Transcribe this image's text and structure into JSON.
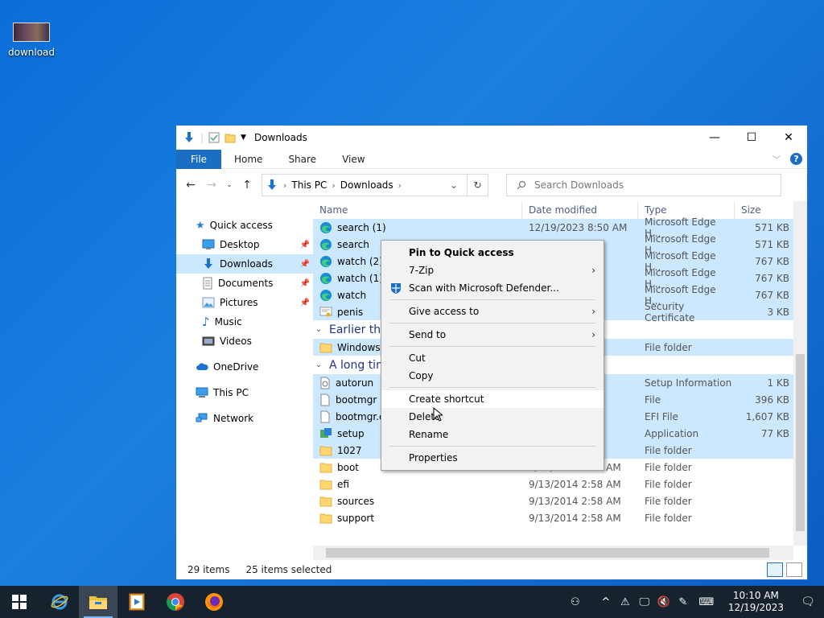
{
  "desktop": {
    "icons": [
      {
        "label": "download"
      }
    ]
  },
  "window": {
    "title": "Downloads",
    "ribbon_tabs": {
      "file": "File",
      "home": "Home",
      "share": "Share",
      "view": "View"
    },
    "address": {
      "root": "This PC",
      "folder": "Downloads"
    },
    "search_placeholder": "Search Downloads"
  },
  "nav_pane": {
    "quick_access": "Quick access",
    "items": [
      {
        "label": "Desktop",
        "icon": "desktop-icon",
        "pinned": true
      },
      {
        "label": "Downloads",
        "icon": "download-icon",
        "pinned": true,
        "selected": true
      },
      {
        "label": "Documents",
        "icon": "documents-icon",
        "pinned": true
      },
      {
        "label": "Pictures",
        "icon": "pictures-icon",
        "pinned": true
      },
      {
        "label": "Music",
        "icon": "music-icon"
      },
      {
        "label": "Videos",
        "icon": "videos-icon"
      }
    ],
    "onedrive": "OneDrive",
    "this_pc": "This PC",
    "network": "Network"
  },
  "columns": {
    "name": "Name",
    "date": "Date modified",
    "type": "Type",
    "size": "Size"
  },
  "files_today": [
    {
      "name": "search (1)",
      "date": "12/19/2023 8:50 AM",
      "type": "Microsoft Edge H...",
      "size": "571 KB",
      "icon": "edge-icon"
    },
    {
      "name": "search",
      "date": "",
      "type": "Microsoft Edge H...",
      "size": "571 KB",
      "icon": "edge-icon"
    },
    {
      "name": "watch (2)",
      "date": "",
      "type": "Microsoft Edge H...",
      "size": "767 KB",
      "icon": "edge-icon"
    },
    {
      "name": "watch (1)",
      "date": "",
      "type": "Microsoft Edge H...",
      "size": "767 KB",
      "icon": "edge-icon"
    },
    {
      "name": "watch",
      "date": "",
      "type": "Microsoft Edge H...",
      "size": "767 KB",
      "icon": "edge-icon"
    },
    {
      "name": "penis",
      "date": "",
      "type": "Security Certificate",
      "size": "3 KB",
      "icon": "certificate-icon"
    }
  ],
  "group_earlier": "Earlier this",
  "files_earlier": [
    {
      "name": "Windows 1",
      "date": "",
      "type": "File folder",
      "size": "",
      "icon": "folder-icon"
    }
  ],
  "group_long": "A long time",
  "files_long": [
    {
      "name": "autorun",
      "date": "",
      "type": "Setup Information",
      "size": "1 KB",
      "icon": "setup-info-icon",
      "sel": true
    },
    {
      "name": "bootmgr",
      "date": "",
      "type": "File",
      "size": "396 KB",
      "icon": "file-icon",
      "sel": true
    },
    {
      "name": "bootmgr.e",
      "date": "",
      "type": "EFI File",
      "size": "1,607 KB",
      "icon": "file-icon",
      "sel": true
    },
    {
      "name": "setup",
      "date": "",
      "type": "Application",
      "size": "77 KB",
      "icon": "setup-app-icon",
      "sel": true
    },
    {
      "name": "1027",
      "date": "",
      "type": "File folder",
      "size": "",
      "icon": "folder-icon",
      "sel": true
    },
    {
      "name": "boot",
      "date": "9/13/2014 2:58 AM",
      "type": "File folder",
      "size": "",
      "icon": "folder-icon",
      "sel": false
    },
    {
      "name": "efi",
      "date": "9/13/2014 2:58 AM",
      "type": "File folder",
      "size": "",
      "icon": "folder-icon",
      "sel": false
    },
    {
      "name": "sources",
      "date": "9/13/2014 2:58 AM",
      "type": "File folder",
      "size": "",
      "icon": "folder-icon",
      "sel": false
    },
    {
      "name": "support",
      "date": "9/13/2014 2:58 AM",
      "type": "File folder",
      "size": "",
      "icon": "folder-icon",
      "sel": false
    }
  ],
  "status": {
    "items": "29 items",
    "selected": "25 items selected"
  },
  "context_menu": {
    "pin": "Pin to Quick access",
    "zip": "7-Zip",
    "scan": "Scan with Microsoft Defender...",
    "give_access": "Give access to",
    "send_to": "Send to",
    "cut": "Cut",
    "copy": "Copy",
    "create_shortcut": "Create shortcut",
    "delete": "Delete",
    "rename": "Rename",
    "properties": "Properties"
  },
  "taskbar": {
    "time": "10:10 AM",
    "date": "12/19/2023"
  },
  "colors": {
    "accent": "#1a6ec4",
    "selection": "#cce8ff",
    "taskbar": "#16222e"
  }
}
